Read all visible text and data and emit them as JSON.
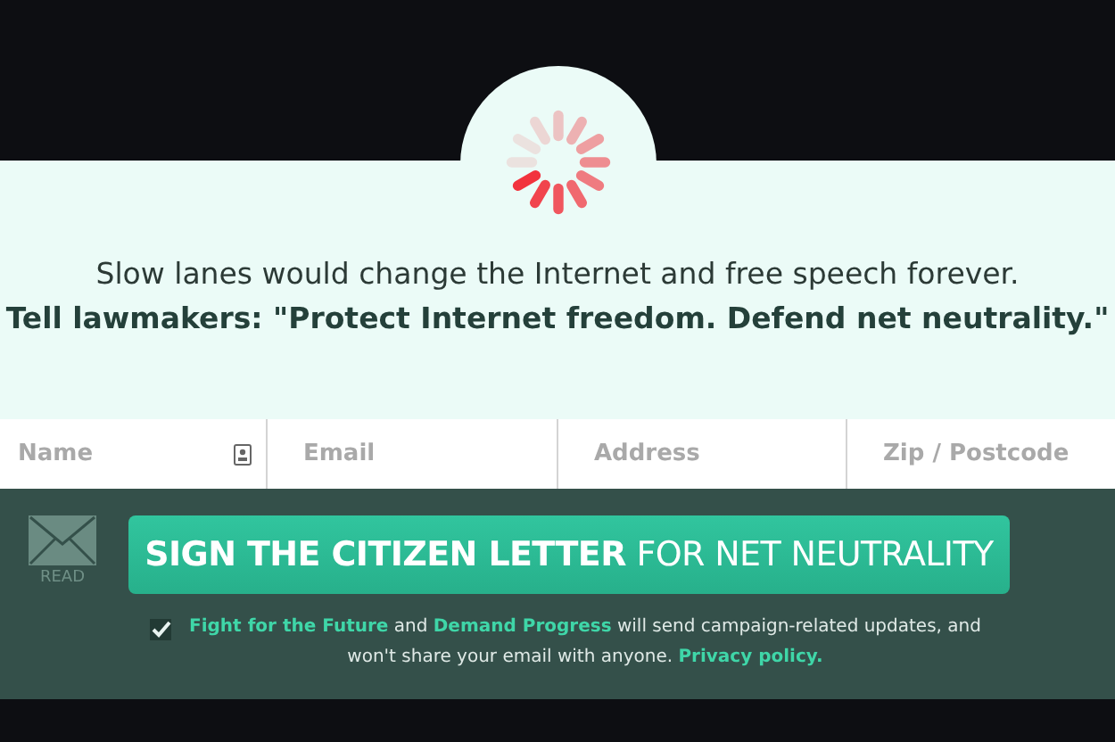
{
  "intro": "Slow lanes would change the Internet and free speech forever.",
  "headline": "Tell lawmakers: \"Protect Internet freedom. Defend net neutrality.\"",
  "fields": [
    {
      "placeholder": "Name",
      "kind": "contact"
    },
    {
      "placeholder": "Email",
      "kind": "plain"
    },
    {
      "placeholder": "Address",
      "kind": "plain"
    },
    {
      "placeholder": "Zip / Postcode",
      "kind": "plain"
    }
  ],
  "read_label": "READ",
  "submit": "**SIGN THE CITIZEN LETTER** FOR NET NEUTRALITY",
  "consent": {
    "checked": true,
    "parts": [
      {
        "kind": "link",
        "text": "Fight for the Future"
      },
      {
        "kind": "text",
        "text": " and "
      },
      {
        "kind": "link",
        "text": "Demand Progress"
      },
      {
        "kind": "text",
        "text": " will send campaign-related updates, and won't share your email with anyone. "
      },
      {
        "kind": "link",
        "text": "Privacy policy."
      }
    ]
  }
}
